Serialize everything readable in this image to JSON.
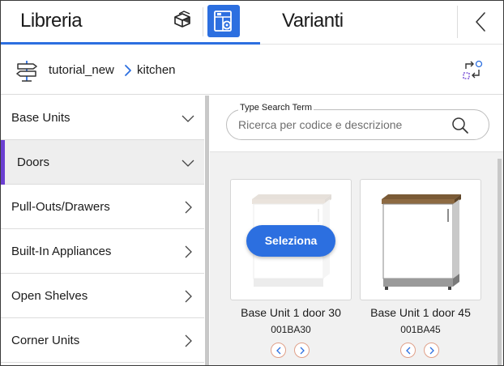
{
  "header": {
    "libreria_label": "Libreria",
    "varianti_label": "Varianti",
    "icons": [
      "box-open-icon",
      "catalog-grid-icon",
      "chevron-left-icon"
    ],
    "accent_color": "#2c6fe0"
  },
  "breadcrumb": {
    "items": [
      "tutorial_new",
      "kitchen"
    ],
    "icons": [
      "signpost-icon",
      "swap-icon"
    ]
  },
  "categories": {
    "items": [
      {
        "label": "Base Units",
        "chevron": "down",
        "active": false
      },
      {
        "label": "Doors",
        "chevron": "down",
        "active": true
      },
      {
        "label": "Pull-Outs/Drawers",
        "chevron": "right",
        "active": false
      },
      {
        "label": "Built-In Appliances",
        "chevron": "right",
        "active": false
      },
      {
        "label": "Open Shelves",
        "chevron": "right",
        "active": false
      },
      {
        "label": "Corner Units",
        "chevron": "right",
        "active": false
      }
    ],
    "active_color": "#6b3fd1"
  },
  "search": {
    "legend": "Type Search Term",
    "placeholder": "Ricerca per codice e descrizione",
    "value": ""
  },
  "products": [
    {
      "name": "Base Unit 1 door 30",
      "code": "001BA30",
      "hovered": true,
      "select_label": "Seleziona"
    },
    {
      "name": "Base Unit 1 door 45",
      "code": "001BA45",
      "hovered": false
    }
  ]
}
